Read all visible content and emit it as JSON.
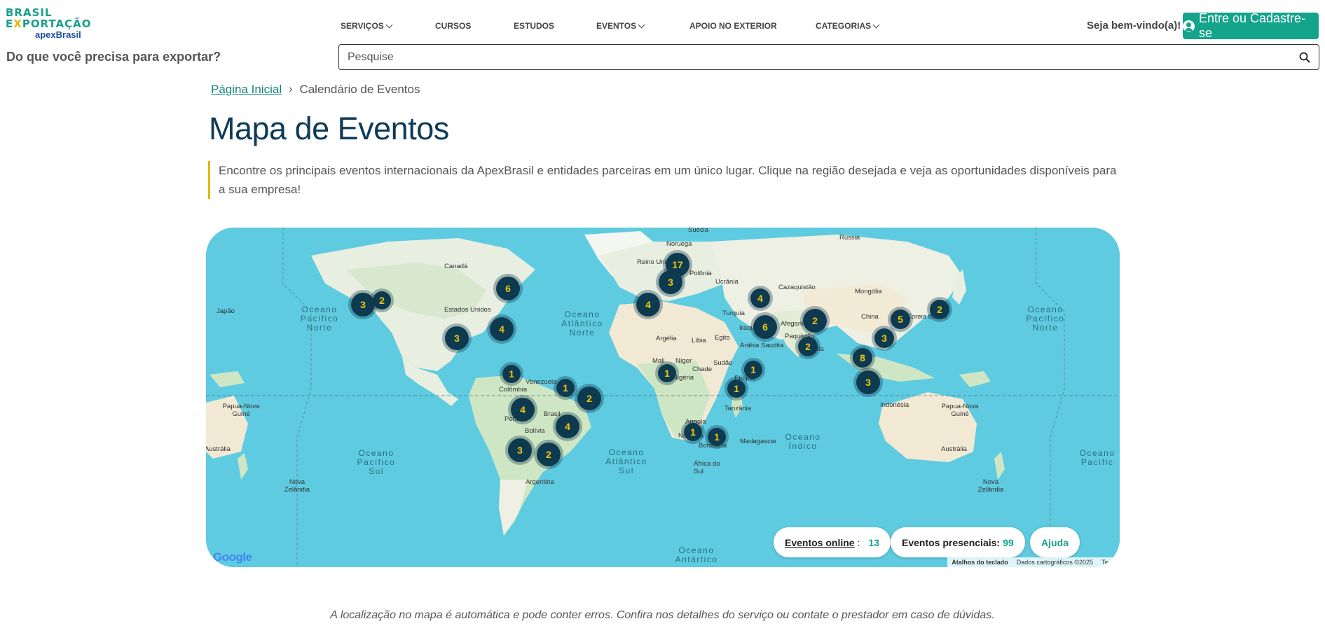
{
  "header": {
    "logo": {
      "line1": "BRASIL",
      "line2_pre": "E",
      "line2_x": "X",
      "line2_post": "PORTAÇÃO",
      "line3": "apexBrasil"
    },
    "tagline": "Do que você precisa para exportar?",
    "nav": [
      {
        "label": "SERVIÇOS",
        "dropdown": true
      },
      {
        "label": "CURSOS",
        "dropdown": false
      },
      {
        "label": "ESTUDOS",
        "dropdown": false
      },
      {
        "label": "EVENTOS",
        "dropdown": true
      },
      {
        "label": "APOIO NO EXTERIOR",
        "dropdown": false
      },
      {
        "label": "CATEGORIAS",
        "dropdown": true
      }
    ],
    "welcome": "Seja bem-vindo(a)!",
    "login_label": "Entre ou Cadastre-se",
    "search_placeholder": "Pesquise"
  },
  "breadcrumb": {
    "home": "Página Inicial",
    "current": "Calendário de Eventos"
  },
  "page_title": "Mapa de Eventos",
  "intro": "Encontre os principais eventos internacionais da ApexBrasil e entidades parceiras em um único lugar. Clique na região desejada e veja as oportunidades disponíveis para a sua empresa!",
  "map": {
    "clusters": [
      "3",
      "2",
      "6",
      "4",
      "3",
      "17",
      "3",
      "4",
      "4",
      "6",
      "2",
      "2",
      "5",
      "2",
      "3",
      "8",
      "3",
      "1",
      "1",
      "1",
      "1",
      "1",
      "2",
      "4",
      "4",
      "3",
      "2",
      "1",
      "1"
    ],
    "labels": [
      "Suécia",
      "Noruega",
      "Rússia",
      "Reino Unido",
      "Polônia",
      "Ucrânia",
      "Canadá",
      "Estados Unidos",
      "Cazaquistão",
      "Mongólia",
      "Japão",
      "Turquia",
      "China",
      "Coreia do Sul",
      "Argélia",
      "Líbia",
      "Egito",
      "Iraque",
      "Afeganistão",
      "Paquistão",
      "Índia",
      "Arábia Saudita",
      "Mali",
      "Níger",
      "Chade",
      "Sudão",
      "Nigéria",
      "Etiópia",
      "Tanzânia",
      "Angola",
      "Namíbia",
      "Botsuana",
      "Madagascar",
      "África do Sul",
      "Venezuela",
      "Colômbia",
      "Peru",
      "Brasil",
      "Bolívia",
      "Argentina",
      "Indonésia",
      "Papua-Nova Guiné",
      "Papua-Nova Guiné",
      "Austrália",
      "Nova Zelândia",
      "Nova Zelândia",
      "Austrália"
    ],
    "oceans": [
      "Oceano Pacífico Norte",
      "Oceano Atlântico Norte",
      "Oceano Pacífico Norte",
      "Oceano Pacífico Sul",
      "Oceano Atlântico Sul",
      "Oceano Índico",
      "Oceano Pacífic",
      "Oceano Antártico"
    ],
    "google": "Google",
    "attrib": [
      "Atalhos do teclado",
      "Dados cartográficos ©2025",
      "Term"
    ],
    "online_label": "Eventos online",
    "online_count": "13",
    "presencial_label": "Eventos presenciais:",
    "presencial_count": "99",
    "help_label": "Ajuda",
    "colors": {
      "water": "#5fcbe0",
      "land": "#eef0e4",
      "forest": "#bfe0b4",
      "desert": "#f3ead6",
      "cluster": "#0e3a4f",
      "cluster_text": "#f2c40f"
    }
  },
  "disclaimer": "A localização no mapa é automática e pode conter erros. Confira nos detalhes do serviço ou contate o prestador em caso de dúvidas."
}
